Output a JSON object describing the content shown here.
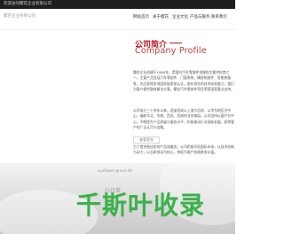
{
  "topbar": {
    "text": "欢迎访问樱花企业有限公司"
  },
  "header": {
    "brand": "樱花企业有限公司"
  },
  "nav": [
    {
      "label": "网站首页"
    },
    {
      "label": "关于樱花"
    },
    {
      "label": "企业文化"
    },
    {
      "label": "产品与服务"
    },
    {
      "label": "联系我们"
    }
  ],
  "profile": {
    "title": "公司简介",
    "subtitle": "Company Profile",
    "paragraphs": [
      "樱花企业创建于1986年，是国内汽车零部件领域的主要供应商之一，主要产品包括汽车零部件、门窗系统、精密制造件、智能装备等，先后获得多项国家级荣誉认证。依托领先的技术研发能力，我们为客户提供整体解决方案，樱花汽车零部件项目荣获国家重点支持。",
      "公司成立三十多年以来，逐渐形成以上海为总部、以华东地区为中心，辐射华北、华南、西北、西南的业务格局。公司坚持以客户为中心，不断提升产品质量与服务水平，积极推动行业创新发展，获得客户的广泛认可与信赖。",
      "为了提供更优质的产品和服务，公司积极开拓国际市场，以技术创新为动力，以品质保证为核心，持续为客户创造更多价值。"
    ],
    "more_label": "查看更多"
  },
  "hero": {
    "hint_top": "sunflower·green·life",
    "hint_mid": "向日葵",
    "main_text": "千斯叶收录"
  }
}
